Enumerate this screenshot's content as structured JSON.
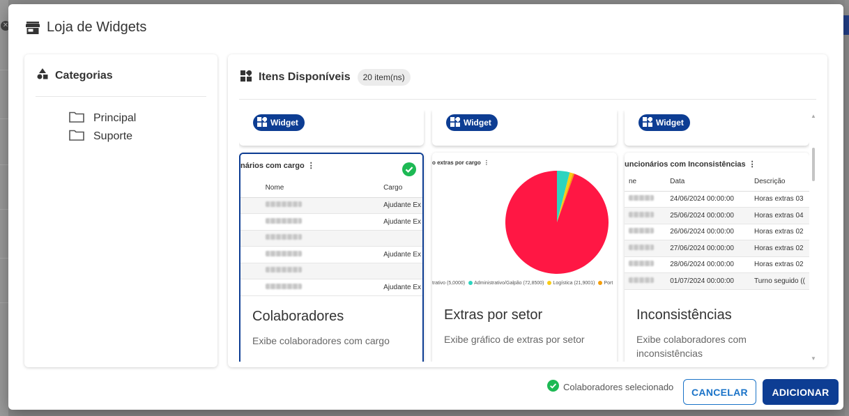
{
  "dialog": {
    "title": "Loja de Widgets",
    "icon": "store-icon"
  },
  "categories": {
    "title": "Categorias",
    "items": [
      {
        "label": "Principal",
        "icon": "folder-icon"
      },
      {
        "label": "Suporte",
        "icon": "folder-icon"
      }
    ]
  },
  "items_panel": {
    "title": "Itens Disponíveis",
    "count": "20 item(ns)",
    "chip_label": "Widget"
  },
  "cards": [
    {
      "title": "Colaboradores",
      "description": "Exibe colaboradores com cargo",
      "selected": true,
      "preview_title": "nários com cargo",
      "columns": [
        "Nome",
        "Cargo"
      ],
      "rows": [
        [
          "",
          "Ajudante Ex"
        ],
        [
          "",
          "Ajudante Ex"
        ],
        [
          "",
          ""
        ],
        [
          "",
          "Ajudante Ex"
        ],
        [
          "",
          ""
        ],
        [
          "",
          "Ajudante Ex"
        ]
      ]
    },
    {
      "title": "Extras por setor",
      "description": "Exibe gráfico de extras por setor",
      "selected": false,
      "preview_title": "o extras por cargo",
      "legend": [
        {
          "label": "trativo (5,0000)",
          "color": ""
        },
        {
          "label": "Administrativo/Galpão (72,8500)",
          "color": "#2dd4bf"
        },
        {
          "label": "Logística (21,9001)",
          "color": "#facc15"
        },
        {
          "label": "Port",
          "color": "#f59e0b"
        }
      ]
    },
    {
      "title": "Inconsistências",
      "description": "Exibe colaboradores com inconsistências",
      "selected": false,
      "preview_title": "uncionários com Inconsistências",
      "columns": [
        "ne",
        "Data",
        "Descrição"
      ],
      "rows": [
        [
          "",
          "24/06/2024 00:00:00",
          "Horas extras 03"
        ],
        [
          "",
          "25/06/2024 00:00:00",
          "Horas extras 04"
        ],
        [
          "",
          "26/06/2024 00:00:00",
          "Horas extras 02"
        ],
        [
          "",
          "27/06/2024 00:00:00",
          "Horas extras 02"
        ],
        [
          "",
          "28/06/2024 00:00:00",
          "Horas extras 02"
        ],
        [
          "",
          "01/07/2024 00:00:00",
          "Turno seguido (("
        ]
      ]
    }
  ],
  "chart_data": {
    "type": "pie",
    "title": "",
    "labels": [
      "Administrativo",
      "Administrativo/Galpão",
      "Logística",
      "Port"
    ],
    "values": [
      5.0,
      72.85,
      21.9001,
      0.6
    ],
    "colors": [
      "#ff1744",
      "#2dd4bf",
      "#facc15",
      "#f59e0b"
    ]
  },
  "footer": {
    "status": "Colaboradores selecionado",
    "cancel_label": "CANCELAR",
    "add_label": "ADICIONAR"
  },
  "colors": {
    "primary": "#0d3d93",
    "outline": "#1a73c8",
    "success": "#1db954",
    "pie_main": "#ff1744"
  }
}
